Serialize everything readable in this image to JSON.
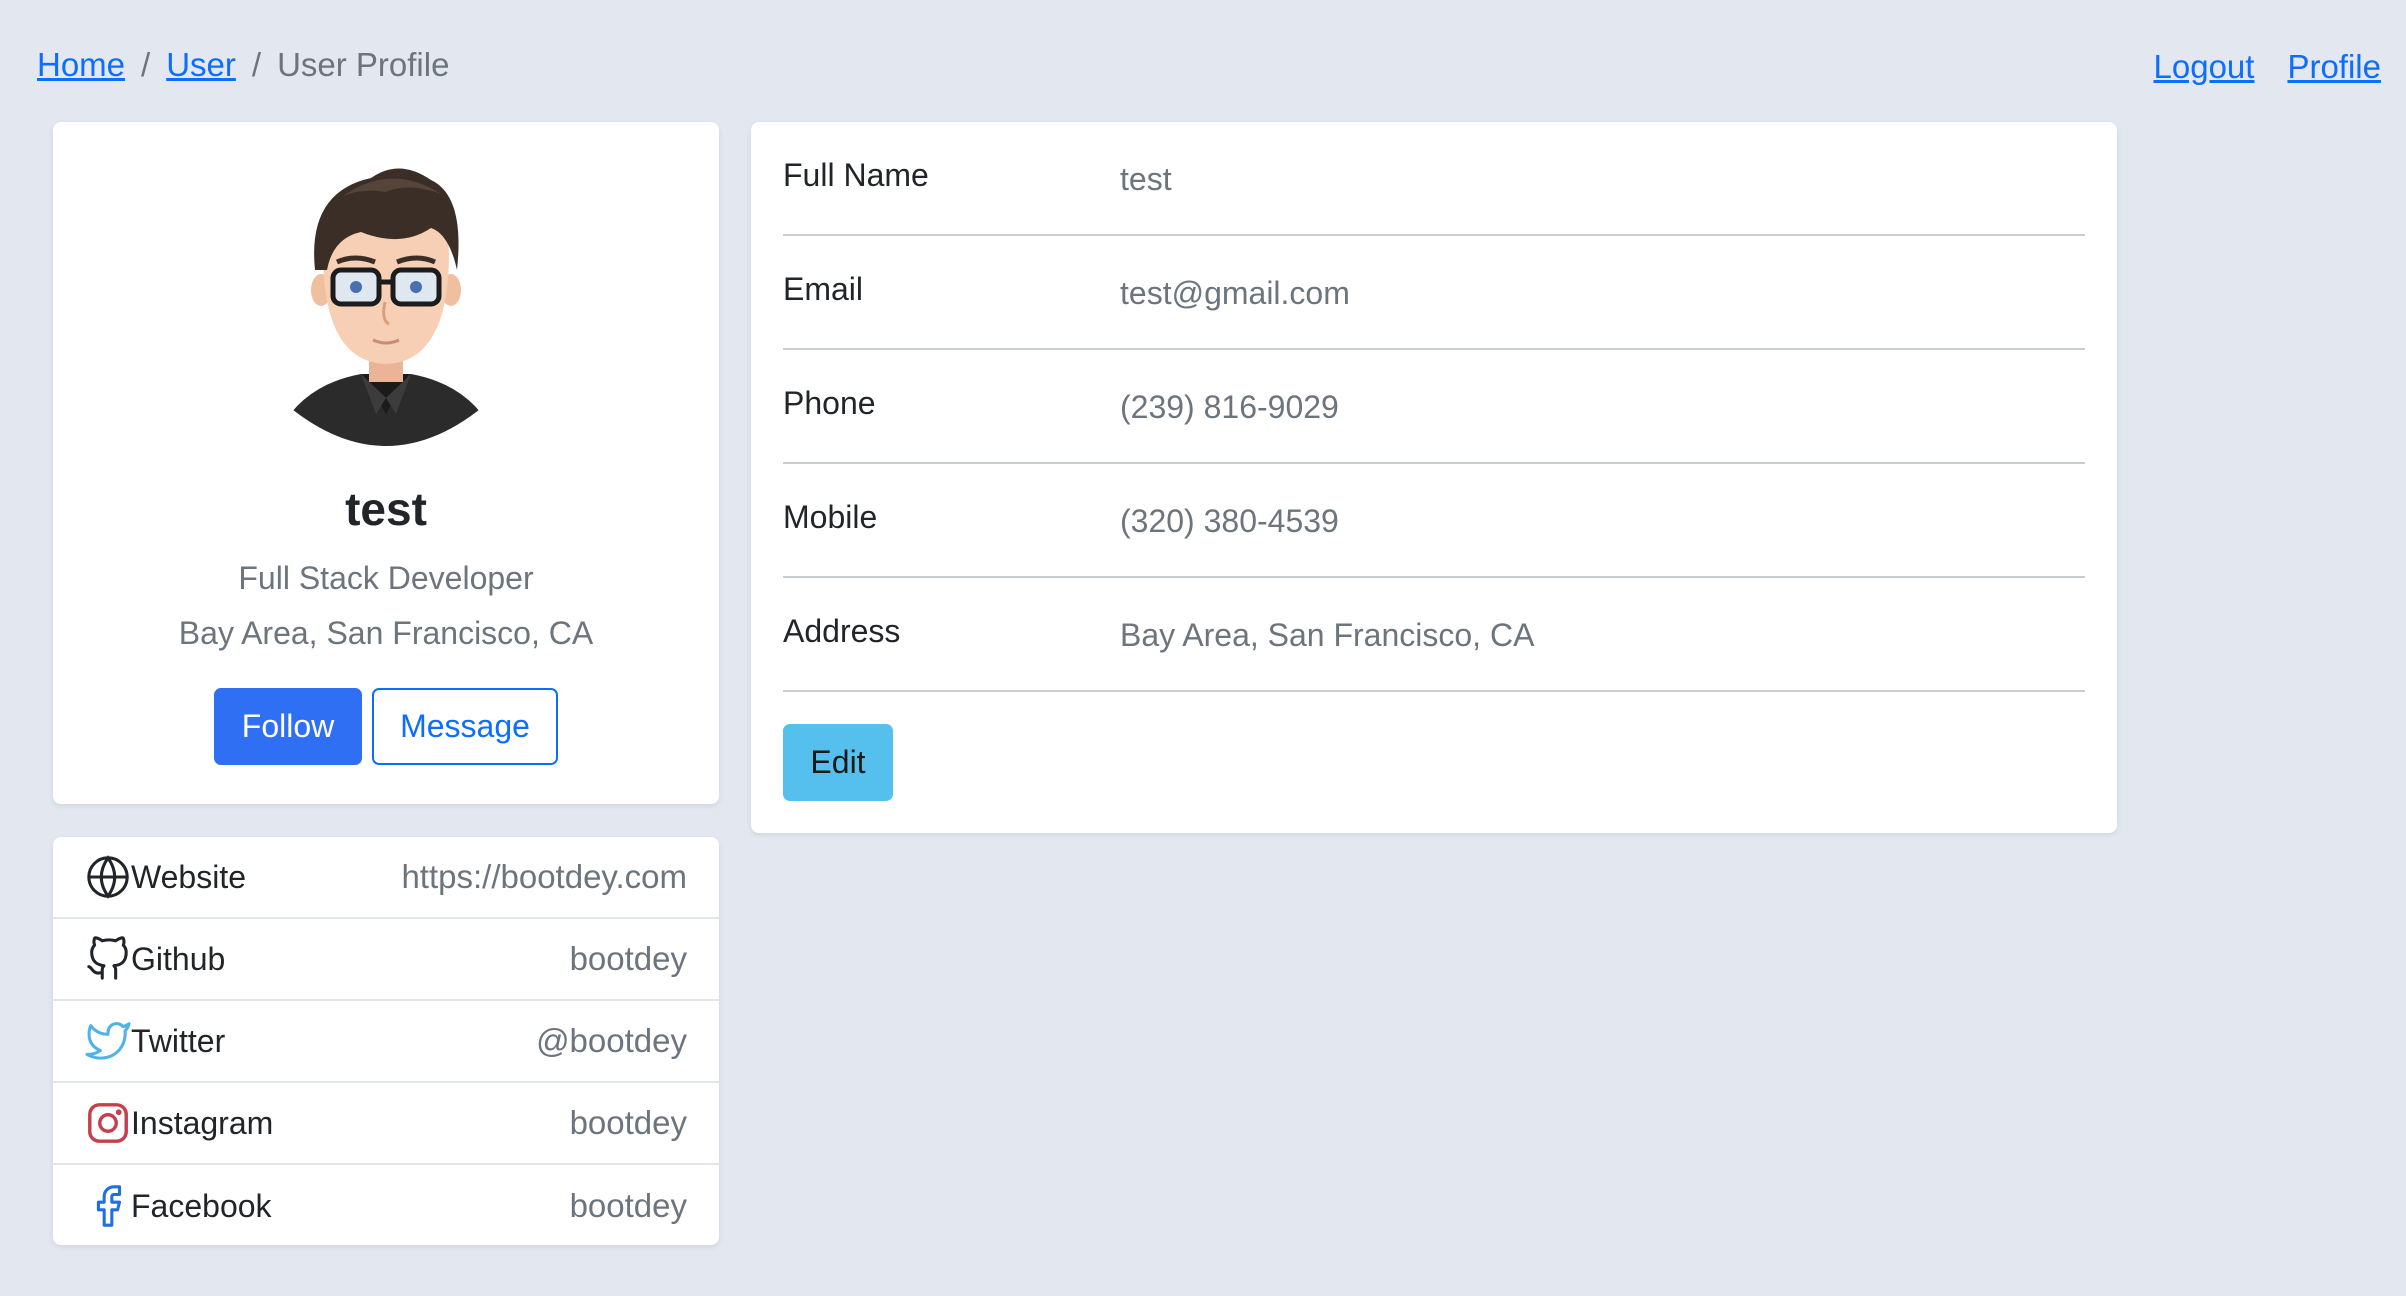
{
  "breadcrumb": {
    "home": "Home",
    "user": "User",
    "current": "User Profile",
    "separator": "/"
  },
  "topnav": {
    "logout": "Logout",
    "profile": "Profile"
  },
  "profile": {
    "name": "test",
    "role": "Full Stack Developer",
    "location": "Bay Area, San Francisco, CA",
    "follow_label": "Follow",
    "message_label": "Message"
  },
  "social": [
    {
      "label": "Website",
      "value": "https://bootdey.com",
      "icon": "globe-icon"
    },
    {
      "label": "Github",
      "value": "bootdey",
      "icon": "github-icon"
    },
    {
      "label": "Twitter",
      "value": "@bootdey",
      "icon": "twitter-icon"
    },
    {
      "label": "Instagram",
      "value": "bootdey",
      "icon": "instagram-icon"
    },
    {
      "label": "Facebook",
      "value": "bootdey",
      "icon": "facebook-icon"
    }
  ],
  "details": [
    {
      "label": "Full Name",
      "value": "test"
    },
    {
      "label": "Email",
      "value": "test@gmail.com"
    },
    {
      "label": "Phone",
      "value": "(239) 816-9029"
    },
    {
      "label": "Mobile",
      "value": "(320) 380-4539"
    },
    {
      "label": "Address",
      "value": "Bay Area, San Francisco, CA"
    }
  ],
  "edit_label": "Edit",
  "colors": {
    "background": "#e2e7f0",
    "link": "#0d6efd",
    "primary_button": "#2f6ff3",
    "edit_button": "#55c0ee",
    "twitter": "#4fb3e8",
    "instagram": "#c4404c",
    "facebook": "#1f6fe0"
  }
}
